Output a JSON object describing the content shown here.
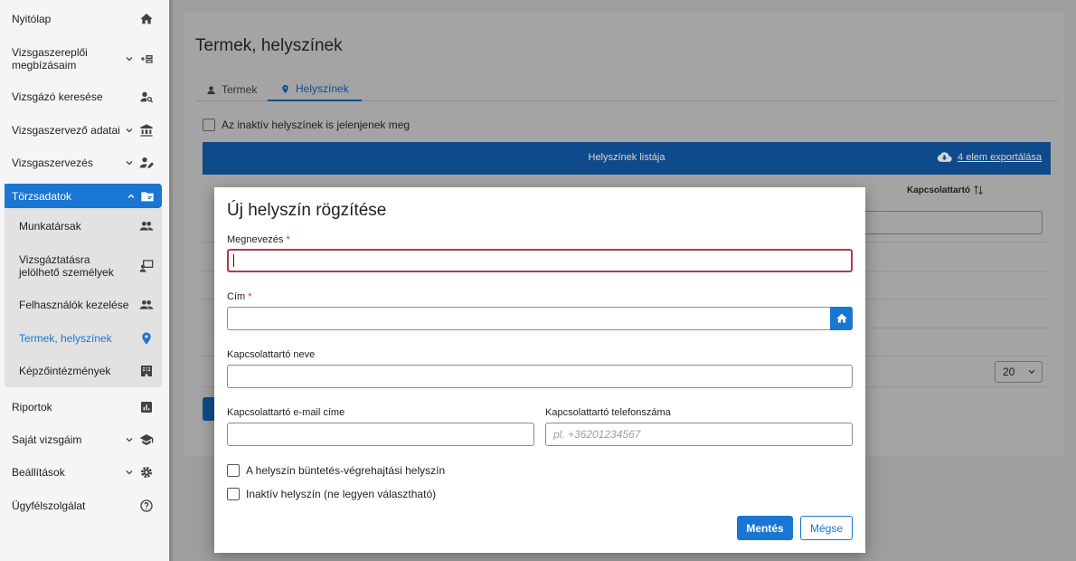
{
  "sidebar": {
    "items": [
      {
        "label": "Nyitólap",
        "icon": "home-icon"
      },
      {
        "label": "Vizsgaszereplői megbízásaim",
        "icon": "assignment-icon"
      },
      {
        "label": "Vizsgázó keresése",
        "icon": "person-search-icon"
      },
      {
        "label": "Vizsgaszervező adatai",
        "icon": "institution-icon"
      },
      {
        "label": "Vizsgaszervezés",
        "icon": "person-edit-icon"
      },
      {
        "label": "Törzsadatok",
        "icon": "folder-icon"
      },
      {
        "label": "Riportok",
        "icon": "chart-icon"
      },
      {
        "label": "Saját vizsgáim",
        "icon": "graduation-cap-icon"
      },
      {
        "label": "Beállítások",
        "icon": "gear-icon"
      },
      {
        "label": "Ügyfélszolgálat",
        "icon": "help-icon"
      }
    ],
    "submenu": [
      {
        "label": "Munkatársak",
        "icon": "people-icon"
      },
      {
        "label": "Vizsgáztatásra jelölhető személyek",
        "icon": "person-board-icon"
      },
      {
        "label": "Felhasználók kezelése",
        "icon": "people-icon"
      },
      {
        "label": "Termek, helyszínek",
        "icon": "location-pin-icon"
      },
      {
        "label": "Képzőintézmények",
        "icon": "building-icon"
      }
    ]
  },
  "main": {
    "title": "Termek, helyszínek",
    "tabs": [
      {
        "label": "Termek",
        "icon": "person-icon"
      },
      {
        "label": "Helyszínek",
        "icon": "location-pin-icon"
      }
    ],
    "inactive_checkbox_label": "Az inaktív helyszínek is jelenjenek meg",
    "list_title": "Helyszínek listája",
    "export_label": "4 elem exportálása",
    "col_contact": "Kapcsolattartó",
    "page_size": "20"
  },
  "modal": {
    "title": "Új helyszín rögzítése",
    "name_label": "Megnevezés",
    "name_value": "",
    "address_label": "Cím",
    "address_value": "",
    "contact_name_label": "Kapcsolattartó neve",
    "contact_name_value": "",
    "contact_email_label": "Kapcsolattartó e-mail címe",
    "contact_email_value": "",
    "contact_phone_label": "Kapcsolattartó telefonszáma",
    "contact_phone_placeholder": "pl. +36201234567",
    "required_mark": "*",
    "checkbox_penal": "A helyszín büntetés-végrehajtási helyszín",
    "checkbox_inactive": "Inaktív helyszín (ne legyen választható)",
    "save_label": "Mentés",
    "cancel_label": "Mégse"
  },
  "colors": {
    "accent": "#1976d2",
    "focus_border": "#b23a48",
    "required": "#d32f2f"
  }
}
